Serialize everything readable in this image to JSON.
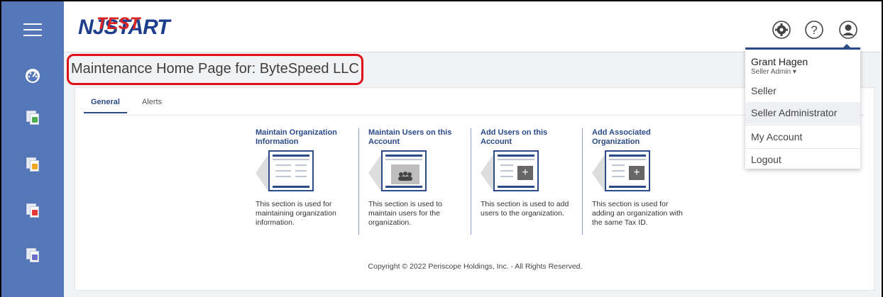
{
  "logo": {
    "brand": "NJSTART",
    "nj": "NJ",
    "start": "START",
    "overlay": "TEST"
  },
  "page": {
    "title": "Maintenance Home Page for: ByteSpeed LLC"
  },
  "tabs": [
    {
      "label": "General",
      "active": true
    },
    {
      "label": "Alerts",
      "active": false
    }
  ],
  "sections": [
    {
      "title": "Maintain Organization Information",
      "description": "This section is used for maintaining organization information."
    },
    {
      "title": "Maintain Users on this Account",
      "description": "This section is used to maintain users for the organization."
    },
    {
      "title": "Add Users on this Account",
      "description": "This section is used to add users to the organization."
    },
    {
      "title": "Add Associated Organization",
      "description": "This section is used for adding an organization with the same Tax ID."
    }
  ],
  "footer": {
    "copyright": "Copyright © 2022 Periscope Holdings, Inc. - All Rights Reserved."
  },
  "user_menu": {
    "name": "Grant Hagen",
    "role": "Seller Admin",
    "role_caret": "▾",
    "items": [
      {
        "label": "Seller"
      },
      {
        "label": "Seller Administrator"
      },
      {
        "label": "My Account"
      },
      {
        "label": "Logout"
      }
    ]
  },
  "colors": {
    "sidebar": "#5577b8",
    "accent": "#2a4a8a",
    "highlight_outline": "#e0101a"
  },
  "icons": {
    "top": [
      "gear-icon",
      "help-icon",
      "user-avatar-icon"
    ],
    "sidebar": [
      "hamburger-menu-icon",
      "dashboard-icon",
      "document-icon",
      "document-icon",
      "document-icon",
      "document-icon"
    ]
  }
}
